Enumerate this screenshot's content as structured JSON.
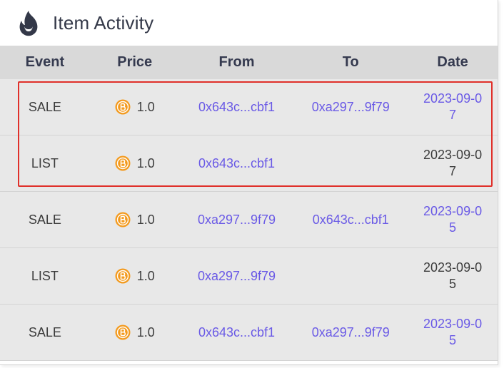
{
  "header": {
    "title": "Item Activity",
    "icon": "flame-icon"
  },
  "columns": {
    "event": "Event",
    "price": "Price",
    "from": "From",
    "to": "To",
    "date": "Date"
  },
  "coin_icon": "coin-icon",
  "colors": {
    "link": "#6a5ae6",
    "coin": "#f39a1e",
    "highlight": "#e0302a",
    "header_bg": "#d9d9d9",
    "row_bg": "#e8e8e8"
  },
  "rows": [
    {
      "event": "SALE",
      "price": "1.0",
      "from": "0x643c...cbf1",
      "to": "0xa297...9f79",
      "date_line1": "2023-09-0",
      "date_line2": "7"
    },
    {
      "event": "LIST",
      "price": "1.0",
      "from": "0x643c...cbf1",
      "to": "",
      "date_line1": "2023-09-0",
      "date_line2": "7"
    },
    {
      "event": "SALE",
      "price": "1.0",
      "from": "0xa297...9f79",
      "to": "0x643c...cbf1",
      "date_line1": "2023-09-0",
      "date_line2": "5"
    },
    {
      "event": "LIST",
      "price": "1.0",
      "from": "0xa297...9f79",
      "to": "",
      "date_line1": "2023-09-0",
      "date_line2": "5"
    },
    {
      "event": "SALE",
      "price": "1.0",
      "from": "0x643c...cbf1",
      "to": "0xa297...9f79",
      "date_line1": "2023-09-0",
      "date_line2": "5"
    }
  ]
}
